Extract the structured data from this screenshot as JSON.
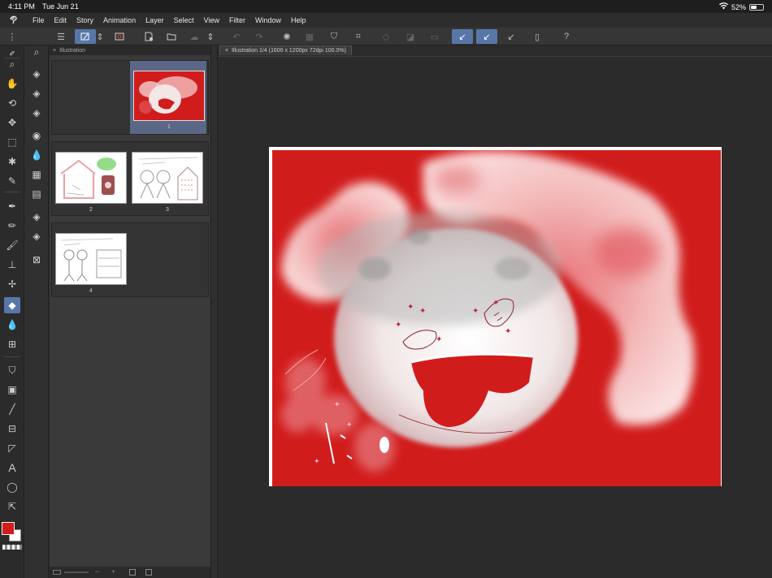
{
  "status": {
    "time": "4:11 PM",
    "date": "Tue Jun 21",
    "battery": "52%",
    "battery_level": 0.52
  },
  "menu": [
    "File",
    "Edit",
    "Story",
    "Animation",
    "Layer",
    "Select",
    "View",
    "Filter",
    "Window",
    "Help"
  ],
  "page_panel": {
    "tab_label": "Illustration",
    "pages": [
      {
        "number": "1",
        "selected": true
      },
      {
        "number": "2",
        "selected": false
      },
      {
        "number": "3",
        "selected": false
      },
      {
        "number": "4",
        "selected": false
      }
    ]
  },
  "canvas": {
    "tab_label": "Illustration 1/4 (1600 x 1200px 72dpi 100.0%)"
  },
  "colors": {
    "main": "#d11c1c",
    "sub": "#ffffff",
    "accent": "#5877a8"
  },
  "tools": [
    "zoom-icon",
    "hand-icon",
    "rotate-icon",
    "move-icon",
    "selection-icon",
    "auto-select-icon",
    "eyedropper-icon",
    "pen-icon",
    "pencil-icon",
    "brush-icon",
    "airbrush-icon",
    "decoration-icon",
    "eraser-icon",
    "blend-icon",
    "figure-icon",
    "fill-icon",
    "gradient-icon",
    "line-icon",
    "frame-icon",
    "ruler-icon",
    "text-icon",
    "balloon-icon",
    "correct-line-icon"
  ]
}
